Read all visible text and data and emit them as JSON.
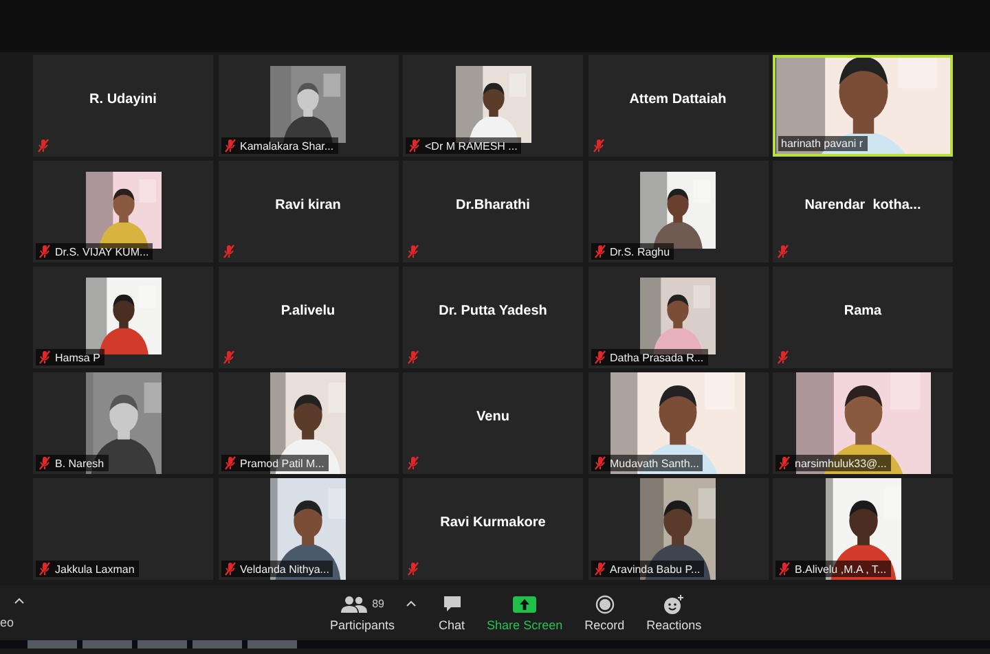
{
  "tiles": [
    {
      "kind": "name",
      "name": "R. Udayini",
      "muted": true,
      "speaking": false
    },
    {
      "label": "Kamalakara Shar...",
      "muted": true,
      "speaking": false
    },
    {
      "label": "<Dr M RAMESH ...",
      "muted": true,
      "speaking": false
    },
    {
      "kind": "name",
      "name": "Attem Dattaiah",
      "muted": true,
      "speaking": false
    },
    {
      "kind": "full",
      "label": "harinath pavani r",
      "muted": false,
      "speaking": true
    },
    {
      "label": "Dr.S. VIJAY KUM...",
      "muted": true,
      "speaking": false
    },
    {
      "kind": "name",
      "name": "Ravi kiran",
      "muted": true,
      "speaking": false
    },
    {
      "kind": "name",
      "name": "Dr.Bharathi",
      "muted": true,
      "speaking": false
    },
    {
      "label": "Dr.S. Raghu",
      "muted": true,
      "speaking": false
    },
    {
      "kind": "name",
      "name": "Narendar  kotha...",
      "muted": true,
      "speaking": false
    },
    {
      "label": "Hamsa P",
      "muted": true,
      "speaking": false
    },
    {
      "kind": "name",
      "name": "P.alivelu",
      "muted": true,
      "speaking": false
    },
    {
      "kind": "name",
      "name": "Dr. Putta Yadesh",
      "muted": true,
      "speaking": false
    },
    {
      "label": "Datha Prasada R...",
      "muted": true,
      "speaking": false
    },
    {
      "kind": "name",
      "name": "Rama",
      "muted": true,
      "speaking": false
    },
    {
      "kind": "portrait",
      "label": "B. Naresh",
      "muted": true,
      "speaking": false
    },
    {
      "kind": "portrait",
      "label": "Pramod Patil M...",
      "muted": true,
      "speaking": false
    },
    {
      "kind": "name",
      "name": "Venu",
      "muted": true,
      "speaking": false
    },
    {
      "kind": "video",
      "label": "Mudavath Santh...",
      "muted": true,
      "speaking": false
    },
    {
      "kind": "video",
      "label": "narsimhuluk33@...",
      "muted": true,
      "speaking": false
    },
    {
      "kind": "blank",
      "label": "Jakkula Laxman",
      "muted": true,
      "speaking": false
    },
    {
      "kind": "portrait",
      "label": "Veldanda Nithya...",
      "muted": true,
      "speaking": false
    },
    {
      "kind": "name",
      "name": "Ravi Kurmakore",
      "muted": true,
      "speaking": false
    },
    {
      "kind": "portrait",
      "label": "Aravinda Babu P...",
      "muted": true,
      "speaking": false
    },
    {
      "kind": "portrait",
      "label": "B.Alivelu ,M.A , T...",
      "muted": true,
      "speaking": false
    }
  ],
  "toolbar": {
    "cut_label": "eo",
    "items": [
      {
        "kind": "participants",
        "label": "Participants",
        "count": "89"
      },
      {
        "kind": "chat",
        "label": "Chat"
      },
      {
        "kind": "share",
        "label": "Share Screen"
      },
      {
        "kind": "record",
        "label": "Record"
      },
      {
        "kind": "reactions",
        "label": "Reactions"
      }
    ]
  }
}
